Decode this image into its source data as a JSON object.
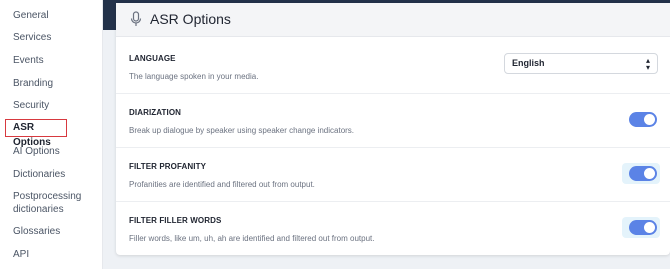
{
  "sidebar": {
    "items": [
      {
        "label": "General"
      },
      {
        "label": "Services"
      },
      {
        "label": "Events"
      },
      {
        "label": "Branding"
      },
      {
        "label": "Security"
      },
      {
        "label": "ASR Options",
        "active": true
      },
      {
        "label": "AI Options"
      },
      {
        "label": "Dictionaries"
      },
      {
        "label": "Postprocessing"
      },
      {
        "label": "dictionaries"
      },
      {
        "label": "Glossaries"
      },
      {
        "label": "API"
      }
    ]
  },
  "panel": {
    "icon": "microphone-icon",
    "title": "ASR Options",
    "rows": [
      {
        "label": "LANGUAGE",
        "description": "The language spoken in your media.",
        "control": "select",
        "value": "English"
      },
      {
        "label": "DIARIZATION",
        "description": "Break up dialogue by speaker using speaker change indicators.",
        "control": "toggle",
        "on": true
      },
      {
        "label": "FILTER PROFANITY",
        "description": "Profanities are identified and filtered out from output.",
        "control": "toggle",
        "on": true
      },
      {
        "label": "FILTER FILLER WORDS",
        "description": "Filler words, like um, uh, ah are identified and filtered out from output.",
        "control": "toggle",
        "on": true
      }
    ]
  },
  "colors": {
    "accent": "#5b83e6",
    "active_border": "#d7393f",
    "header_dark": "#23324a"
  }
}
